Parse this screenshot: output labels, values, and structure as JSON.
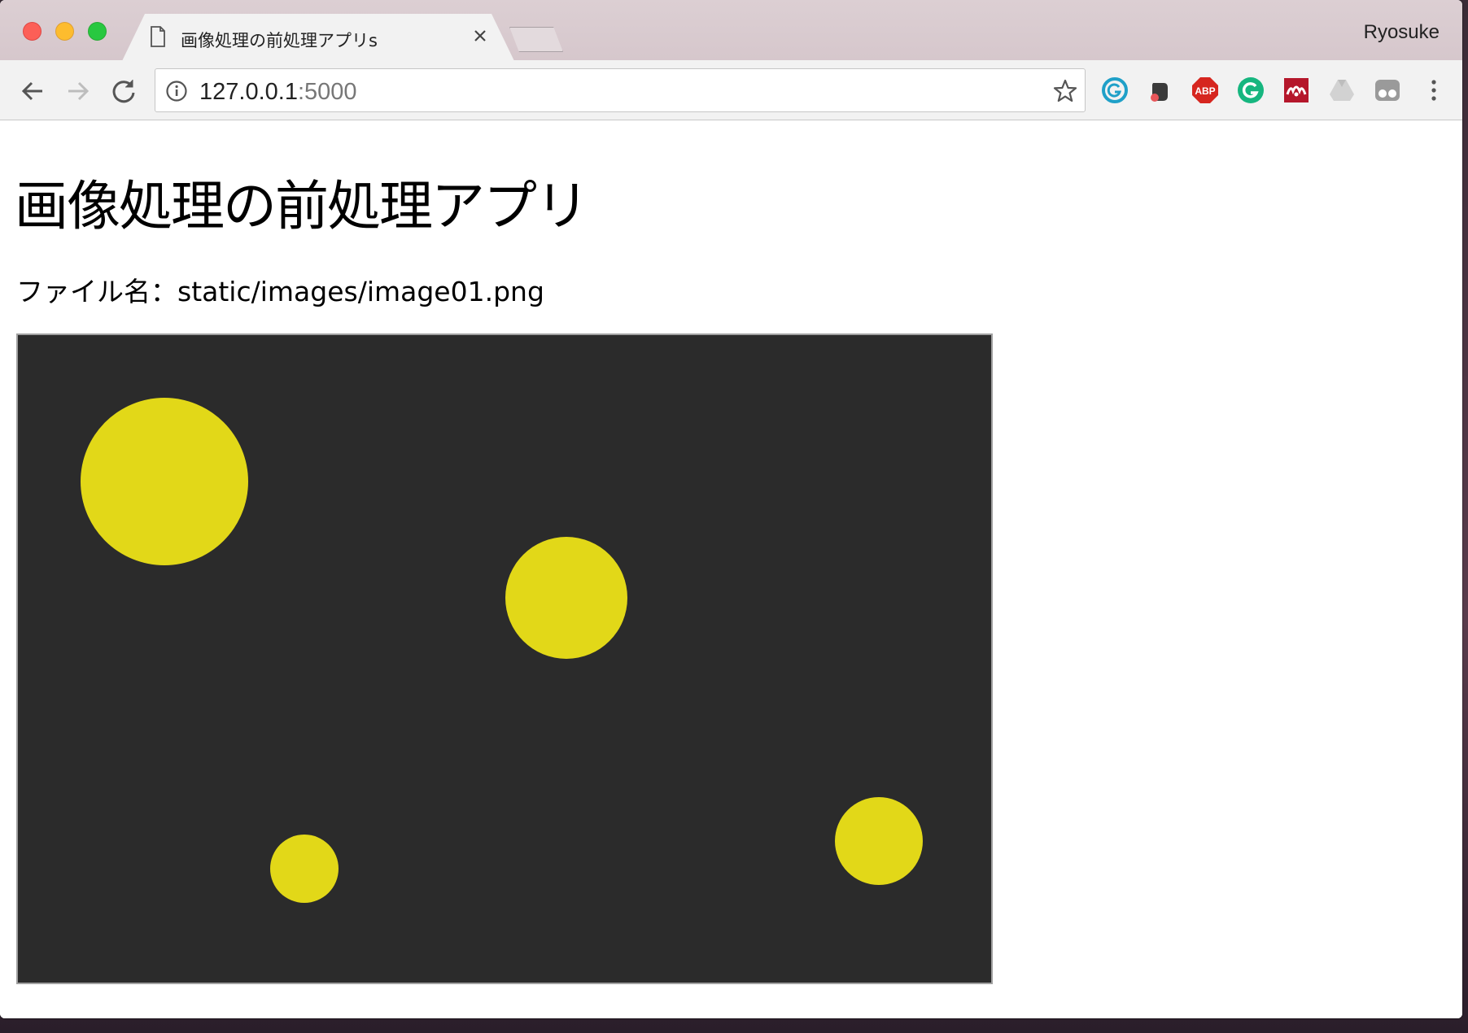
{
  "window": {
    "traffic_lights": [
      "close",
      "minimize",
      "maximize"
    ],
    "profile_name": "Ryosuke"
  },
  "tab": {
    "title": "画像処理の前処理アプリs",
    "icon": "document-icon",
    "close_icon": "close-icon"
  },
  "toolbar": {
    "back_icon": "arrow-left-icon",
    "forward_icon": "arrow-right-icon",
    "reload_icon": "reload-icon",
    "url_host": "127.0.0.1",
    "url_port": ":5000",
    "info_icon": "info-icon",
    "bookmark_icon": "star-icon",
    "extensions": [
      {
        "name": "grammarly-blue-icon",
        "color": "#1fa0c8"
      },
      {
        "name": "evernote-icon",
        "color": "#3b3b3b"
      },
      {
        "name": "adblock-plus-icon",
        "label": "ABP",
        "color": "#d6261f"
      },
      {
        "name": "grammarly-green-icon",
        "color": "#16b67f"
      },
      {
        "name": "mendeley-icon",
        "color": "#b5172b"
      },
      {
        "name": "google-drive-icon",
        "color": "#c8c8c8"
      },
      {
        "name": "extension-grey-icon",
        "color": "#9a9a9a"
      }
    ],
    "menu_icon": "kebab-menu-icon"
  },
  "page": {
    "heading": "画像処理の前処理アプリ",
    "filename_label": "ファイル名：static/images/image01.png",
    "image": {
      "background": "#2b2b2b",
      "circle_color": "#e2d818"
    }
  }
}
